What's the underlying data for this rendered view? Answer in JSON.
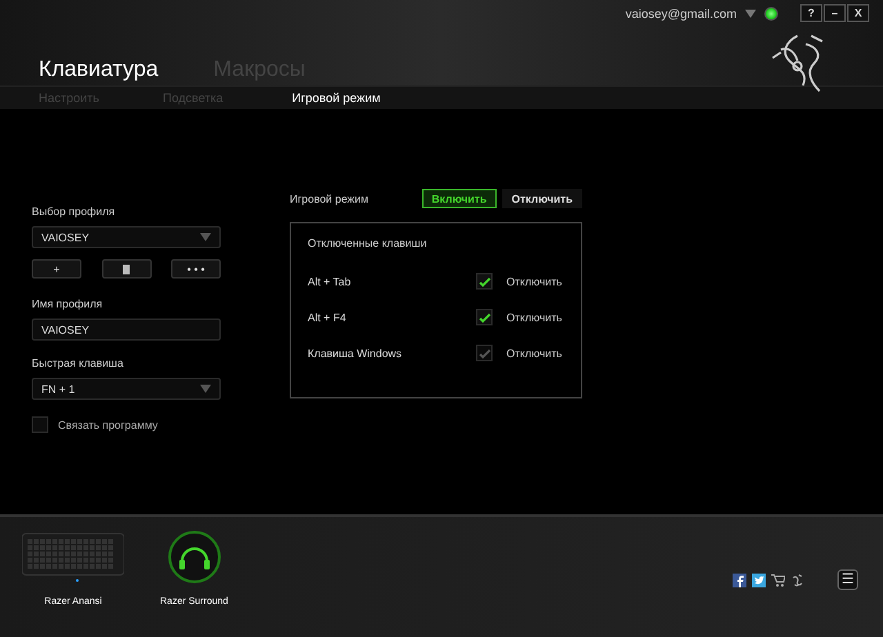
{
  "header": {
    "account": "vaiosey@gmail.com",
    "online": true,
    "window_buttons": [
      "?",
      "–",
      "X"
    ]
  },
  "tabs": [
    {
      "label": "Клавиатура",
      "selected": true
    },
    {
      "label": "Макросы",
      "selected": false
    }
  ],
  "subtabs": [
    {
      "label": "Настроить",
      "selected": false
    },
    {
      "label": "Подсветка",
      "selected": false
    },
    {
      "label": "Игровой режим",
      "selected": true
    }
  ],
  "profile": {
    "select_label": "Выбор профиля",
    "select_value": "VAIOSEY",
    "buttons": [
      {
        "kind": "text",
        "label": "+"
      },
      {
        "kind": "trash"
      },
      {
        "kind": "text",
        "label": "• • •"
      }
    ],
    "name_label": "Имя профиля",
    "name_value": "VAIOSEY",
    "hotkey_label": "Быстрая клавиша",
    "hotkey_value": "FN + 1",
    "link_program": {
      "label": "Связать программу",
      "checked": false
    }
  },
  "game_mode": {
    "label": "Игровой режим",
    "options": [
      {
        "label": "Включить",
        "selected": true
      },
      {
        "label": "Отключить",
        "selected": false
      }
    ],
    "panel_title": "Отключенные клавиши",
    "keys": [
      {
        "name": "Alt + Tab",
        "checked": true,
        "disabled": false,
        "action": "Отключить"
      },
      {
        "name": "Alt + F4",
        "checked": true,
        "disabled": false,
        "action": "Отключить"
      },
      {
        "name": "Клавиша Windows",
        "checked": true,
        "disabled": true,
        "action": "Отключить"
      }
    ]
  },
  "footer": {
    "devices": [
      {
        "kind": "keyboard",
        "name": "Razer Anansi"
      },
      {
        "kind": "headset",
        "name": "Razer Surround"
      }
    ],
    "menu_button": "☰"
  }
}
